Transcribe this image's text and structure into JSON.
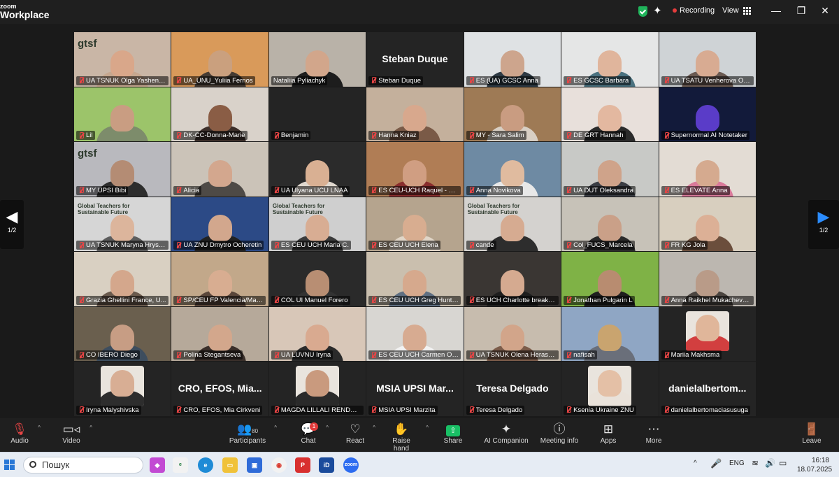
{
  "app": {
    "brand_top": "zoom",
    "brand_bottom": "Workplace",
    "recording_label": "Recording",
    "view_label": "View"
  },
  "pager": {
    "left": "1/2",
    "right": "1/2"
  },
  "participants": [
    {
      "name": "UA TSNUK Olga Yashenk...",
      "bg": "#c9b6a6",
      "skin": "#d9a78a",
      "shirt": "#c6a78f",
      "logo": "gtsf"
    },
    {
      "name": "UA_UNU_Yuliia Fernos",
      "bg": "#d99a5a",
      "skin": "#caa07e",
      "shirt": "#463c33"
    },
    {
      "name": "Nataliia Pyliachyk",
      "bg": "#b9b2a8",
      "skin": "#d2a68b",
      "shirt": "#1d1d1d",
      "active": true
    },
    {
      "name": "Steban Duque",
      "big": "Steban Duque"
    },
    {
      "name": "ES (UA) GCSC Anna",
      "bg": "#dfe2e4",
      "skin": "#cda58d",
      "shirt": "#2e3a44"
    },
    {
      "name": "ES GCSC Barbara",
      "bg": "#e5e6e6",
      "skin": "#e0b59c",
      "shirt": "#4a7280"
    },
    {
      "name": "UA TSATU Venherova Ole...",
      "bg": "#cfd3d6",
      "skin": "#d8ab92",
      "shirt": "#6b5a52"
    },
    {
      "name": "Lil",
      "bg": "#9cc46a",
      "skin": "#c99d82",
      "shirt": "#7d8c6b"
    },
    {
      "name": "DK-CC-Donna-Marie",
      "bg": "#d9d2ca",
      "skin": "#8a5d45",
      "shirt": "#3c2f2a"
    },
    {
      "name": "Benjamin",
      "dark": true
    },
    {
      "name": "Hanna Kniaz",
      "bg": "#c4b09c",
      "skin": "#d8a88d",
      "shirt": "#7a5a47"
    },
    {
      "name": "MY - Sara Salim",
      "bg": "#9e7a55",
      "skin": "#c99c81",
      "shirt": "#d8cfc4"
    },
    {
      "name": "DE GRT Hannah",
      "bg": "#e8e0db",
      "skin": "#e3b8a0",
      "shirt": "#2b2b2b"
    },
    {
      "name": "Supernormal AI Notetaker",
      "bg": "#121a3a",
      "skin": "#5a3cc8",
      "shirt": "#121a3a"
    },
    {
      "name": "MY UPSI Bibi",
      "bg": "#b9b9be",
      "skin": "#b48c74",
      "shirt": "#2d2d2d",
      "logo": "gtsf"
    },
    {
      "name": "Alicia",
      "bg": "#cbc3b8",
      "skin": "#d3a78e",
      "shirt": "#4e4a46"
    },
    {
      "name": "UA Ulyana UCU LNAA",
      "bg": "#2b2b2b",
      "skin": "#d9b093",
      "shirt": "#e0d8cf"
    },
    {
      "name": "ES CEU-UCH Raquel - Sus...",
      "bg": "#b07d55",
      "skin": "#d09e82",
      "shirt": "#8a2d2d"
    },
    {
      "name": "Anna Novikova",
      "bg": "#6e8aa3",
      "skin": "#e0bb9f",
      "shirt": "#e8e8e8"
    },
    {
      "name": "UA DUT Oleksandra",
      "bg": "#c8c9c6",
      "skin": "#cfa38a",
      "shirt": "#3a3d44"
    },
    {
      "name": "ES ELEVATE Anna",
      "bg": "#e3dcd4",
      "skin": "#d5aa8f",
      "shirt": "#d97a9a"
    },
    {
      "name": "UA TSNUK Maryna Hryse...",
      "bg": "#d6d6d6",
      "skin": "#dcb59c",
      "shirt": "#5d5d5d",
      "logo": "Global Teachers for Sustainable Future"
    },
    {
      "name": "UA ZNU Dmytro Ocheretin",
      "bg": "#2c4a86",
      "skin": "#d2a78d",
      "shirt": "#222"
    },
    {
      "name": "ES CEU UCH Maria C.",
      "bg": "#cfcfcf",
      "skin": "#d8ad93",
      "shirt": "#3b3b3b",
      "logo": "Global Teachers for Sustainable Future"
    },
    {
      "name": "ES CEU UCH Elena",
      "bg": "#b5a48e",
      "skin": "#d8ad90",
      "shirt": "#e1d6c8"
    },
    {
      "name": "cande",
      "bg": "#d4d2cf",
      "skin": "#d6ab91",
      "shirt": "#2d2d2d",
      "logo": "Global Teachers for Sustainable Future"
    },
    {
      "name": "Col_FUCS_Marcela",
      "bg": "#c7c2b8",
      "skin": "#caa088",
      "shirt": "#2a2a2a"
    },
    {
      "name": "FR KG Jola",
      "bg": "#d8cfbf",
      "skin": "#dcb096",
      "shirt": "#6b4e3c"
    },
    {
      "name": "Grazia Ghellini France, U...",
      "bg": "#d9d0c2",
      "skin": "#d4a78c",
      "shirt": "#6a5a4d"
    },
    {
      "name": "SP/CEU FP Valencia/Mad...",
      "bg": "#c2a88a",
      "skin": "#d8ad91",
      "shirt": "#5a463a"
    },
    {
      "name": "COL UI Manuel Forero",
      "bg": "#2a2a2a",
      "skin": "#b88e73",
      "shirt": "#333"
    },
    {
      "name": "ES CEU UCH Greg Hunt fr...",
      "bg": "#cabfae",
      "skin": "#d6a98d",
      "shirt": "#5f6f82"
    },
    {
      "name": "ES UCH Charlotte break-o...",
      "bg": "#3a3633",
      "skin": "#d5aa90",
      "shirt": "#1e1e1e"
    },
    {
      "name": "Jonathan Pulgarin L",
      "bg": "#7fb246",
      "skin": "#b88c70",
      "shirt": "#1f1f1f"
    },
    {
      "name": "Anna Raikhel Mukachevo ...",
      "bg": "#bcb7b0",
      "skin": "#b99b88",
      "shirt": "#4b4540"
    },
    {
      "name": "CO IBERO Diego",
      "bg": "#6a5f4e",
      "skin": "#c79d84",
      "shirt": "#3d4d5e"
    },
    {
      "name": "Polina Stegantseva",
      "bg": "#b6a99a",
      "skin": "#d3a78c",
      "shirt": "#3a2f2a"
    },
    {
      "name": "UA LUVNU Iryna",
      "bg": "#d8c7b8",
      "skin": "#d9aa90",
      "shirt": "#2a2a2a"
    },
    {
      "name": "ES CEU UCH Carmen Oliv...",
      "bg": "#d8d6d2",
      "skin": "#d7ab91",
      "shirt": "#f2f2f2"
    },
    {
      "name": "UA TSNUK Olena Herasy...",
      "bg": "#c7bcae",
      "skin": "#d2a58a",
      "shirt": "#7c5c4a"
    },
    {
      "name": "nafisah",
      "bg": "#8fa6c4",
      "skin": "#c9a46f",
      "shirt": "#6a6f7a"
    },
    {
      "name": "Mariia Makhsma",
      "dark": true,
      "thumb": true,
      "skin": "#e0b69a",
      "shirt": "#d23f3f"
    },
    {
      "name": "Iryna Malyshivska",
      "dark": true,
      "thumb": true,
      "skin": "#d8ae94",
      "shirt": "#2d2d2d"
    },
    {
      "name": "CRO, EFOS, Mia Cirkveni",
      "big": "CRO, EFOS, Mia..."
    },
    {
      "name": "MAGDA LILLALI RENDON...",
      "dark": true,
      "thumb": true,
      "skin": "#c99a7e",
      "shirt": "#2a2a2a"
    },
    {
      "name": "MSIA UPSI Marzita",
      "big": "MSIA UPSI Mar..."
    },
    {
      "name": "Teresa Delgado",
      "big": "Teresa Delgado"
    },
    {
      "name": "Ksenia Ukraine ZNU",
      "dark": true,
      "thumb": true,
      "skin": "#e4c0a6",
      "shirt": "#e9e2da"
    },
    {
      "name": "danielalbertomaciasusuga",
      "big": "danielalbertom..."
    }
  ],
  "toolbar": {
    "audio": "Audio",
    "video": "Video",
    "participants": "Participants",
    "participants_count": "80",
    "chat": "Chat",
    "chat_badge": "1",
    "react": "React",
    "raise_hand": "Raise hand",
    "share": "Share",
    "ai_companion": "AI Companion",
    "meeting_info": "Meeting info",
    "apps": "Apps",
    "more": "More",
    "leave": "Leave"
  },
  "taskbar": {
    "search_placeholder": "Пошук",
    "lang": "ENG",
    "time": "16:18",
    "date": "18.07.2025"
  }
}
